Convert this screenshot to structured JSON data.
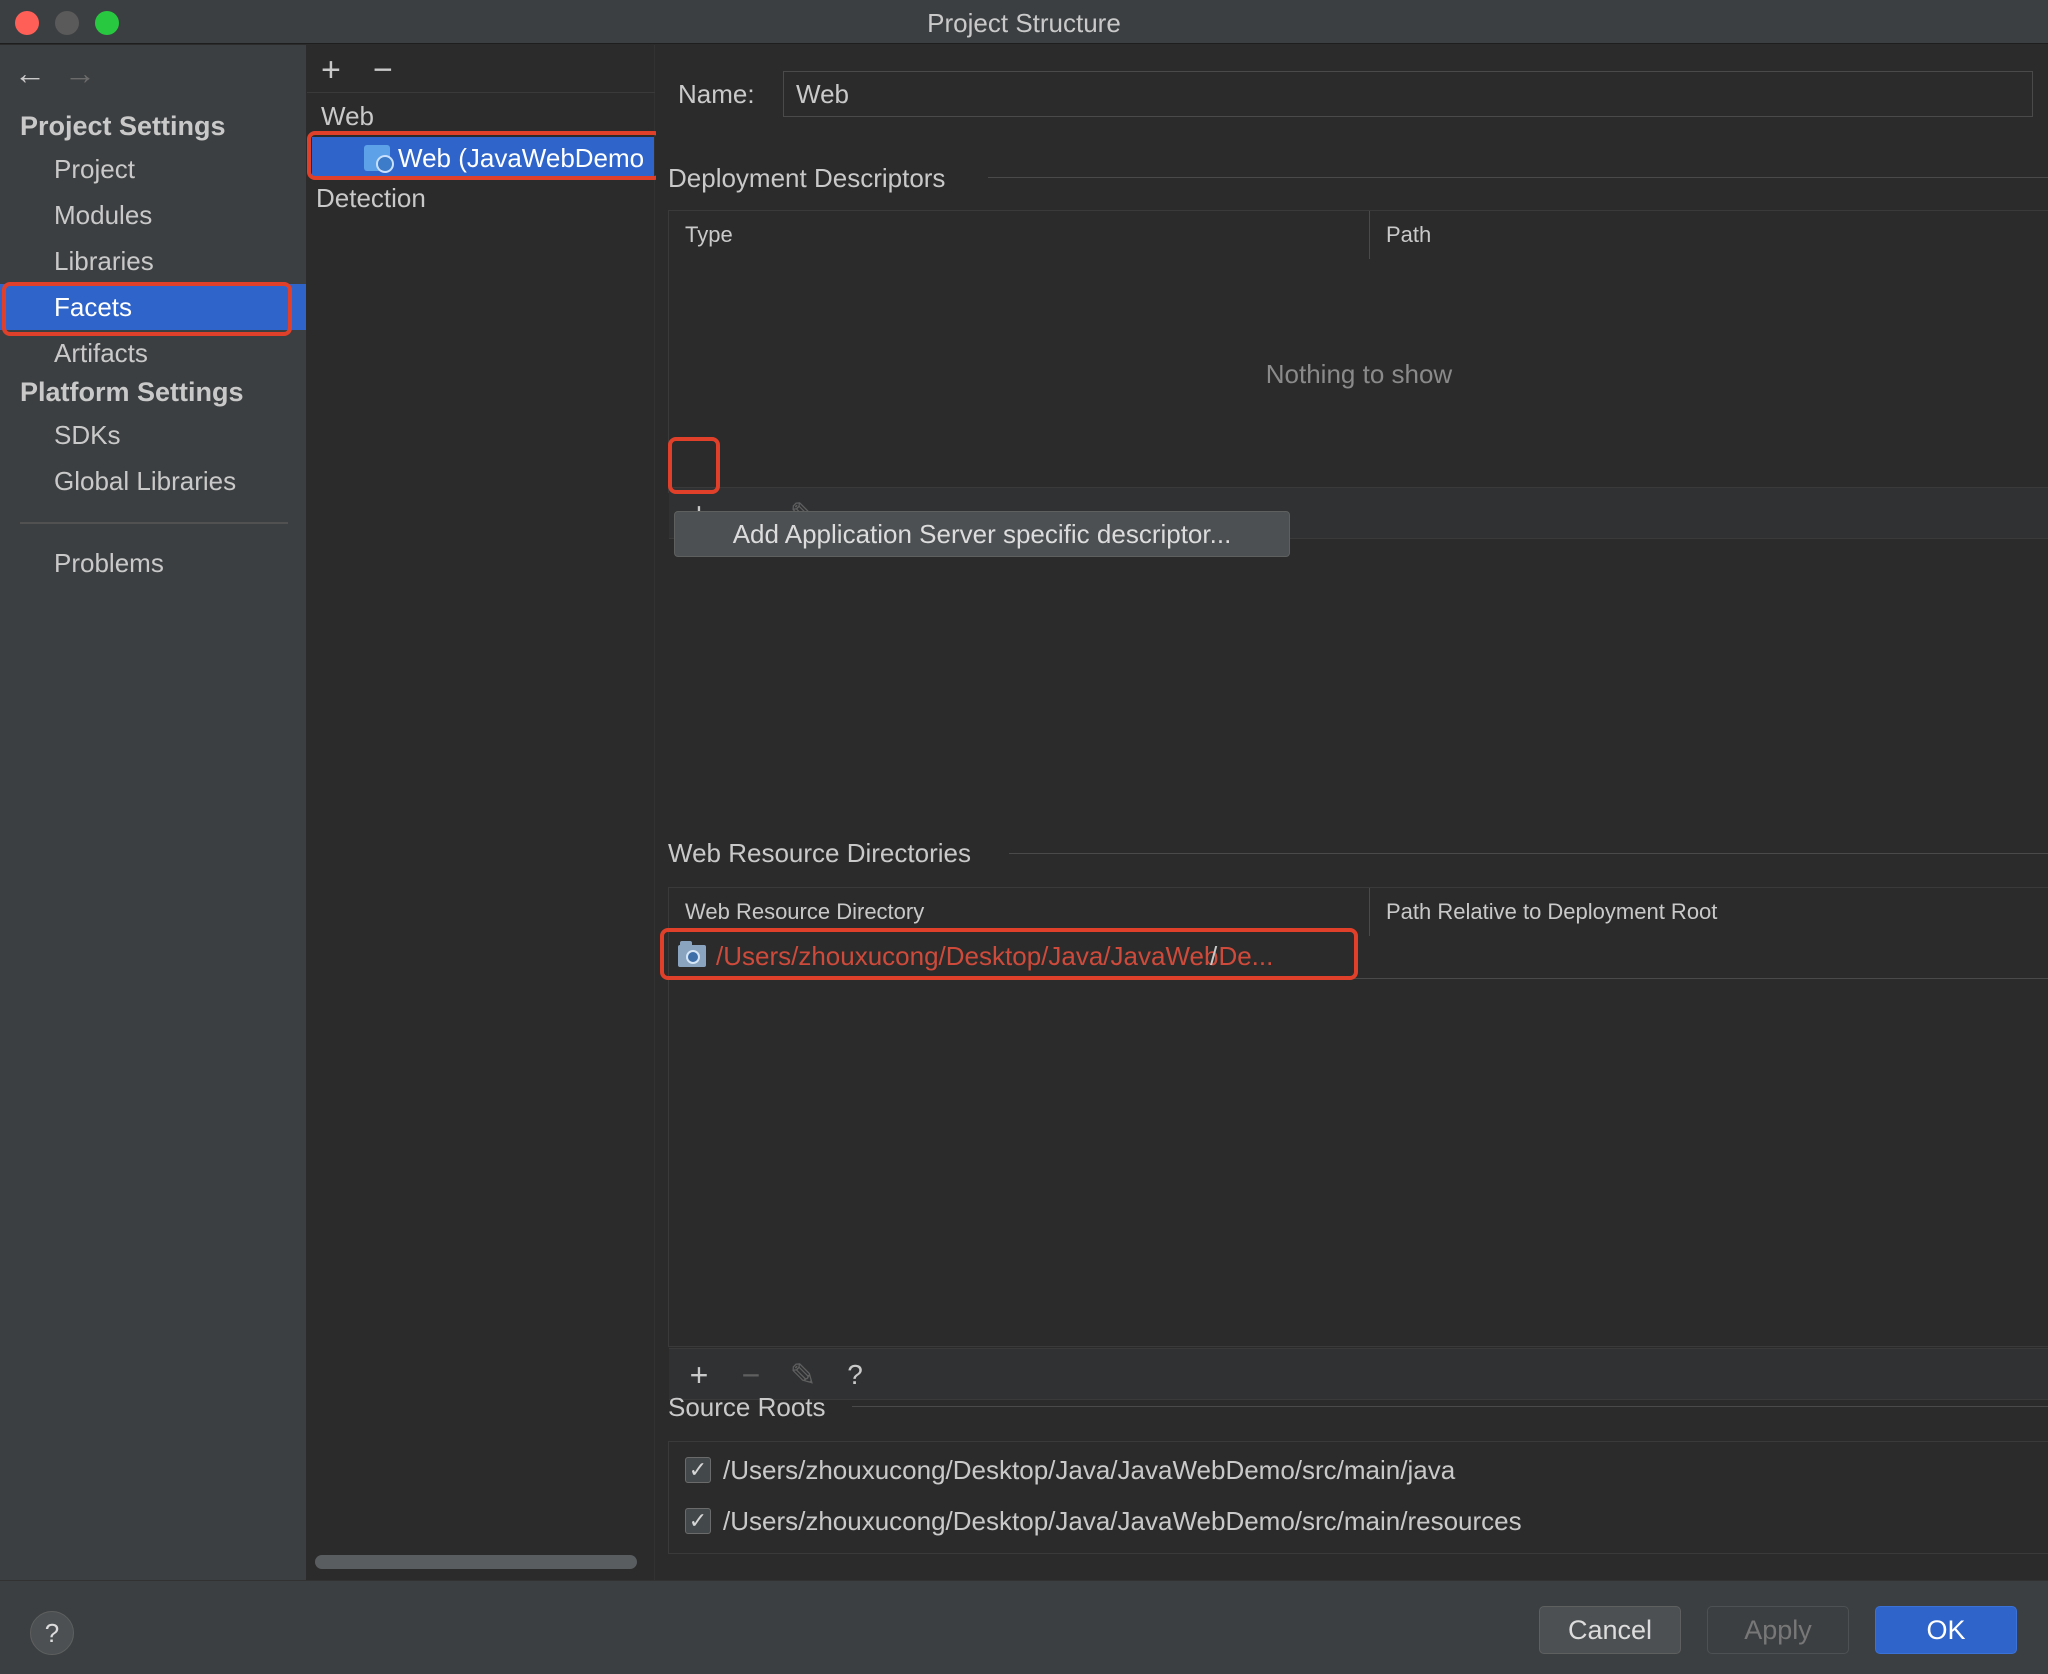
{
  "window": {
    "title": "Project Structure"
  },
  "nav": {
    "back": "←",
    "forward": "→",
    "project_settings_header": "Project Settings",
    "project_items": [
      "Project",
      "Modules",
      "Libraries",
      "Facets",
      "Artifacts"
    ],
    "selected_item": "Facets",
    "platform_settings_header": "Platform Settings",
    "platform_items": [
      "SDKs",
      "Global Libraries"
    ],
    "problems": "Problems"
  },
  "facets": {
    "add": "+",
    "remove": "−",
    "root": "Web",
    "item": "Web (JavaWebDemo",
    "detection": "Detection"
  },
  "content": {
    "name_label": "Name:",
    "name_value": "Web",
    "deployment": {
      "title": "Deployment Descriptors",
      "col_type": "Type",
      "col_path": "Path",
      "empty": "Nothing to show",
      "add": "+",
      "remove": "−",
      "edit": "✎",
      "add_server_button": "Add Application Server specific descriptor..."
    },
    "web_resources": {
      "title": "Web Resource Directories",
      "col_dir": "Web Resource Directory",
      "col_rel": "Path Relative to Deployment Root",
      "row_dir": "/Users/zhouxucong/Desktop/Java/JavaWebDe...",
      "row_rel": "/",
      "add": "+",
      "remove": "−",
      "edit": "✎",
      "help": "?"
    },
    "source_roots": {
      "title": "Source Roots",
      "items": [
        "/Users/zhouxucong/Desktop/Java/JavaWebDemo/src/main/java",
        "/Users/zhouxucong/Desktop/Java/JavaWebDemo/src/main/resources"
      ],
      "check": "✓"
    }
  },
  "footer": {
    "help": "?",
    "cancel": "Cancel",
    "apply": "Apply",
    "ok": "OK"
  },
  "colors": {
    "selection": "#2f65ca",
    "highlight": "#e0402a",
    "error_path": "#ce4a3a"
  }
}
